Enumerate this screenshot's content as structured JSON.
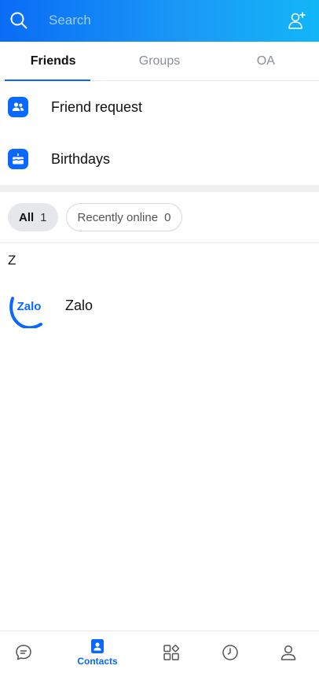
{
  "header": {
    "search_placeholder": "Search",
    "search_icon": "search-icon",
    "add_friend_icon": "add-user-icon"
  },
  "tabs": [
    {
      "label": "Friends",
      "active": true
    },
    {
      "label": "Groups",
      "active": false
    },
    {
      "label": "OA",
      "active": false
    }
  ],
  "shortcuts": [
    {
      "label": "Friend request",
      "icon": "users-icon"
    },
    {
      "label": "Birthdays",
      "icon": "cake-icon"
    }
  ],
  "filters": {
    "all": {
      "label": "All",
      "count": "1"
    },
    "recent": {
      "label": "Recently online",
      "count": "0"
    }
  },
  "contacts": {
    "section_letter": "Z",
    "items": [
      {
        "name": "Zalo",
        "avatar_text": "Zalo"
      }
    ]
  },
  "bottom_nav": [
    {
      "icon": "chat-icon",
      "label": ""
    },
    {
      "icon": "contacts-icon",
      "label": "Contacts",
      "active": true
    },
    {
      "icon": "apps-icon",
      "label": ""
    },
    {
      "icon": "clock-icon",
      "label": ""
    },
    {
      "icon": "profile-icon",
      "label": ""
    }
  ],
  "colors": {
    "accent": "#0a68ff",
    "header_start": "#0a6cf5",
    "header_end": "#12b6f7"
  }
}
